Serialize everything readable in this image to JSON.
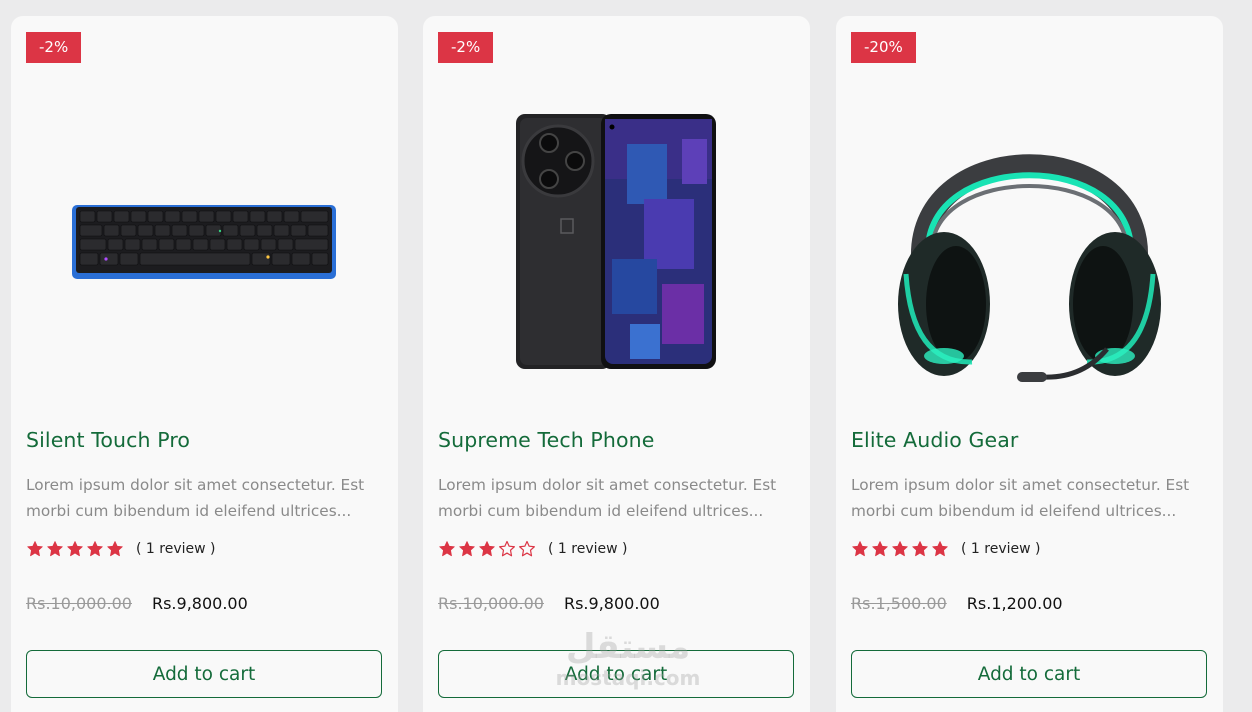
{
  "products": [
    {
      "discount": "-2%",
      "title": "Silent Touch Pro",
      "desc_line1": "Lorem ipsum dolor sit amet consectetur. Est",
      "desc_line2": "morbi cum bibendum id eleifend ultrices...",
      "rating": 5,
      "reviews": "( 1 review )",
      "old_price": "Rs.10,000.00",
      "price": "Rs.9,800.00",
      "button": "Add to cart",
      "image_icon": "keyboard-image"
    },
    {
      "discount": "-2%",
      "title": "Supreme Tech Phone",
      "desc_line1": "Lorem ipsum dolor sit amet consectetur. Est",
      "desc_line2": "morbi cum bibendum id eleifend ultrices...",
      "rating": 3,
      "reviews": "( 1 review )",
      "old_price": "Rs.10,000.00",
      "price": "Rs.9,800.00",
      "button": "Add to cart",
      "image_icon": "phone-image"
    },
    {
      "discount": "-20%",
      "title": "Elite Audio Gear",
      "desc_line1": "Lorem ipsum dolor sit amet consectetur. Est",
      "desc_line2": "morbi cum bibendum id eleifend ultrices...",
      "rating": 5,
      "reviews": "( 1 review )",
      "old_price": "Rs.1,500.00",
      "price": "Rs.1,200.00",
      "button": "Add to cart",
      "image_icon": "headphones-image"
    }
  ],
  "watermark": {
    "arabic": "مستقل",
    "latin": "mostaqi.com"
  },
  "colors": {
    "accent": "#146b3a",
    "badge": "#dc3545",
    "star": "#dc3545"
  }
}
